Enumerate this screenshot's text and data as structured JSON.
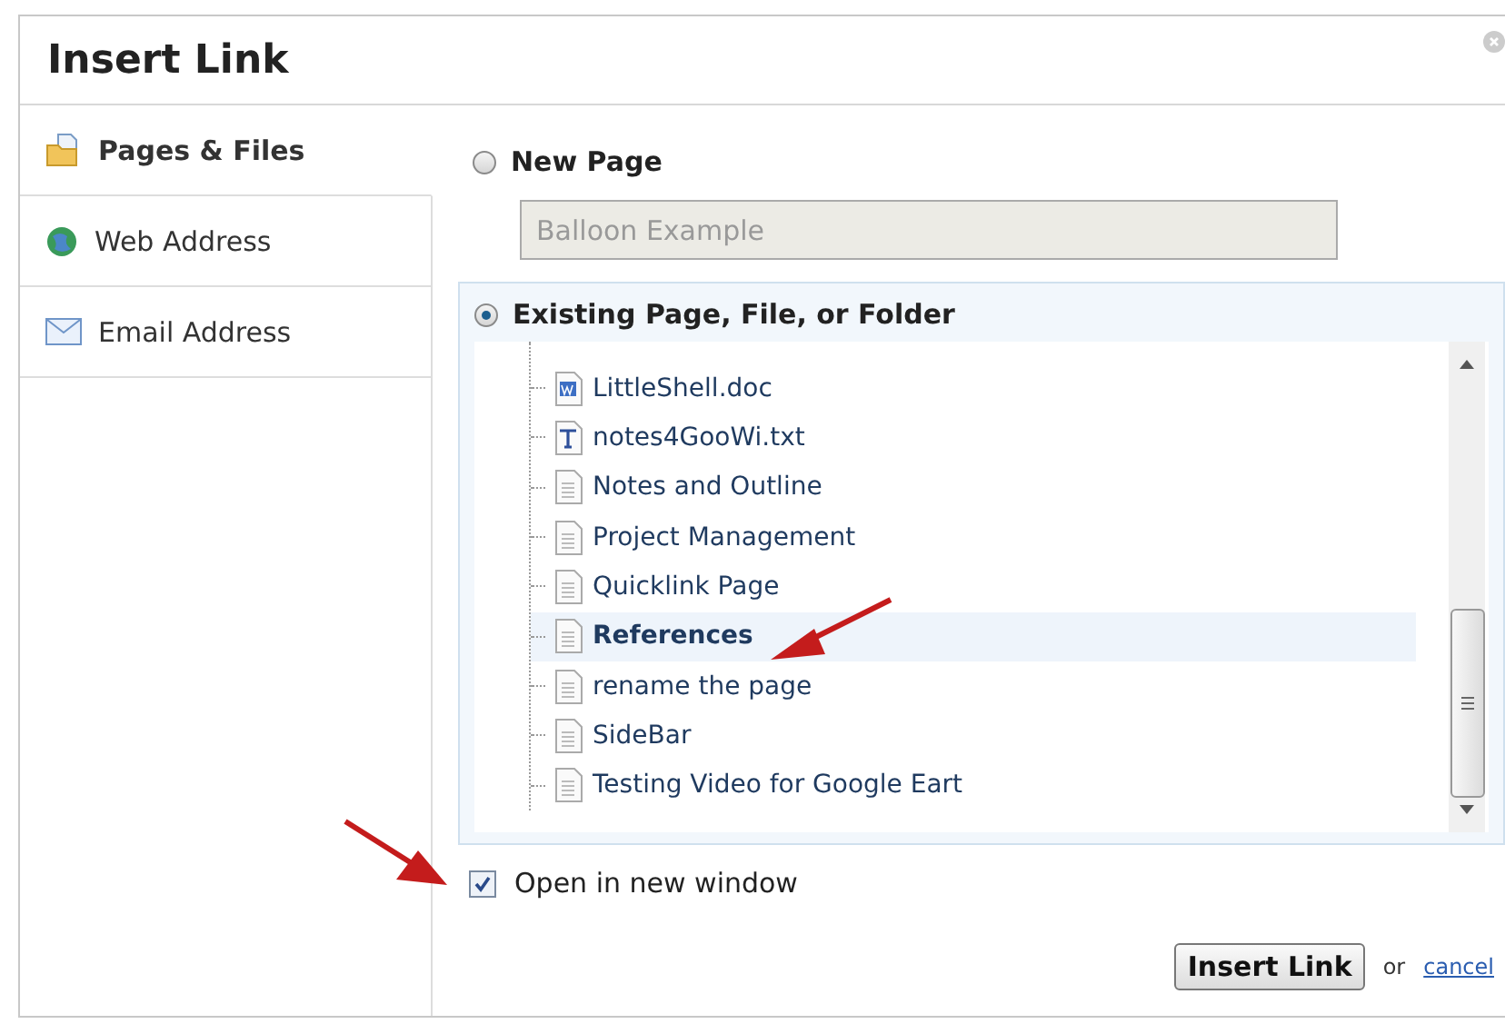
{
  "window": {
    "title": "Insert Link"
  },
  "sidebar": {
    "items": [
      {
        "label": "Pages & Files",
        "kind": "folder",
        "selected": true
      },
      {
        "label": "Web Address",
        "kind": "globe",
        "selected": false
      },
      {
        "label": "Email Address",
        "kind": "mail",
        "selected": false
      }
    ]
  },
  "new_page": {
    "label": "New Page",
    "selected": false,
    "value": "Balloon Example",
    "disabled": true
  },
  "existing": {
    "label": "Existing Page, File, or Folder",
    "selected": true,
    "items": [
      {
        "label": "LittleShell.doc",
        "kind": "doc",
        "selected": false
      },
      {
        "label": "notes4GooWi.txt",
        "kind": "txt",
        "selected": false
      },
      {
        "label": "Notes and Outline",
        "kind": "page",
        "selected": false
      },
      {
        "label": "Project Management",
        "kind": "page",
        "selected": false
      },
      {
        "label": "Quicklink Page",
        "kind": "page",
        "selected": false
      },
      {
        "label": "References",
        "kind": "page",
        "selected": true
      },
      {
        "label": "rename the page",
        "kind": "page",
        "selected": false
      },
      {
        "label": "SideBar",
        "kind": "page",
        "selected": false
      },
      {
        "label": "Testing Video for Google Eart",
        "kind": "page",
        "selected": false
      }
    ]
  },
  "open_new_window": {
    "label": "Open in new window",
    "checked": true
  },
  "footer": {
    "button": "Insert Link",
    "separator": "or",
    "link": "cancel"
  }
}
